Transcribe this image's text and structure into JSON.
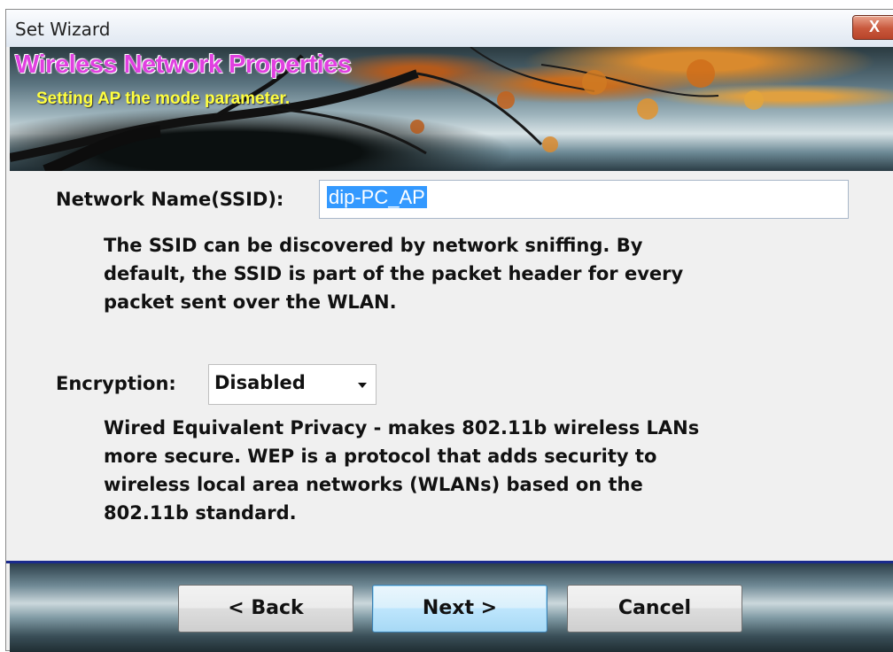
{
  "window": {
    "title": "Set Wizard",
    "close_label": "X"
  },
  "banner": {
    "title": "Wireless Network Properties",
    "subtitle": "Setting AP the mode parameter."
  },
  "form": {
    "ssid_label": "Network Name(SSID):",
    "ssid_value": "dip-PC_AP",
    "ssid_description": "The SSID can be discovered by network sniffing. By\ndefault, the SSID is part of the packet header for every\npacket sent over the WLAN.",
    "encryption_label": "Encryption:",
    "encryption_value": "Disabled",
    "encryption_description": "Wired Equivalent Privacy - makes 802.11b wireless LANs\nmore secure. WEP is a protocol that adds security to\nwireless local area networks (WLANs) based on the\n802.11b standard."
  },
  "buttons": {
    "back": "< Back",
    "next": "Next >",
    "cancel": "Cancel"
  },
  "colors": {
    "banner_title": "#e040e0",
    "banner_subtitle": "#ffff40",
    "selection": "#3399ff",
    "divider": "#1a2a8c"
  }
}
